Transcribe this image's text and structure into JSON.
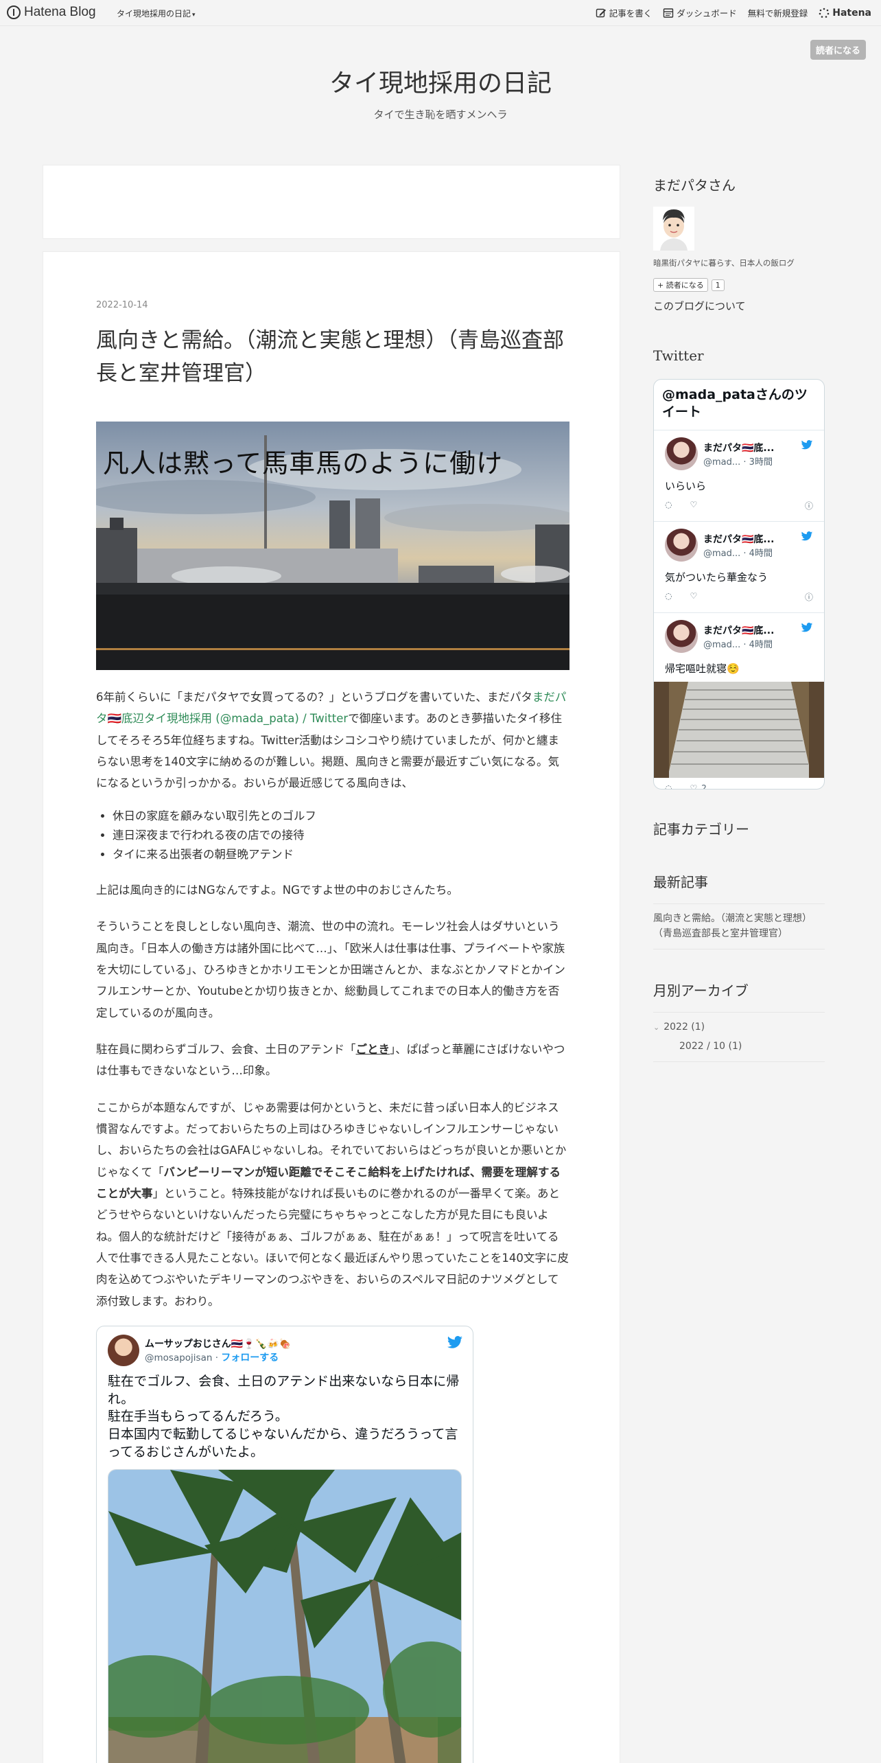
{
  "global_header": {
    "brand": "Hatena Blog",
    "blog_selector": "タイ現地採用の日記",
    "menu": {
      "write": "記事を書く",
      "dashboard": "ダッシュボード",
      "signup": "無料で新規登録",
      "hatena": "Hatena"
    }
  },
  "subscribe_button": "読者になる",
  "blog": {
    "title": "タイ現地採用の日記",
    "description": "タイで生き恥を晒すメンヘラ"
  },
  "entry": {
    "date": "2022-10-14",
    "title": "風向きと需給。（潮流と実態と理想）（青島巡査部長と室井管理官）",
    "eyecatch_caption": "凡人は黙って馬車馬のように働け",
    "p1_a": "6年前くらいに「まだパタヤで女買ってるの？」というブログを書いていた、まだパタ",
    "p1_link": "まだパタ🇹🇭底辺タイ現地採用 (@mada_pata) / Twitter",
    "p1_b": "で御座います。あのとき夢描いたタイ移住してそろそろ5年位経ちますね。Twitter活動はシコシコやり続けていましたが、何かと纏まらない思考を140文字に納めるのが難しい。掲題、風向きと需要が最近すごい気になる。気になるというか引っかかる。おいらが最近感じてる風向きは、",
    "list": [
      "休日の家庭を顧みない取引先とのゴルフ",
      "連日深夜まで行われる夜の店での接待",
      "タイに来る出張者の朝昼晩アテンド"
    ],
    "p2": "上記は風向き的にはNGなんですよ。NGですよ世の中のおじさんたち。",
    "p3": "そういうことを良しとしない風向き、潮流、世の中の流れ。モーレツ社会人はダサいという風向き。「日本人の働き方は諸外国に比べて…」、「欧米人は仕事は仕事、プライベートや家族を大切にしている」、ひろゆきとかホリエモンとか田端さんとか、まなぶとかノマドとかインフルエンサーとか、Youtubeとか切り抜きとか、総動員してこれまでの日本人的働き方を否定しているのが風向き。",
    "p4_a": "駐在員に関わらずゴルフ、会食、土日のアテンド「",
    "p4_em": "ごとき",
    "p4_b": "」、ぱぱっと華麗にさばけないやつは仕事もできないなという…印象。",
    "p5_a": "ここからが本題なんですが、じゃあ需要は何かというと、未だに昔っぽい日本人的ビジネス慣習なんですよ。だっておいらたちの上司はひろゆきじゃないしインフルエンサーじゃないし、おいらたちの会社はGAFAじゃないしね。それでいておいらはどっちが良いとか悪いとかじゃなくて「",
    "p5_strong": "バンピーリーマンが短い距離でそこそこ給料を上げたければ、需要を理解することが大事",
    "p5_b": "」ということ。特殊技能がなければ長いものに巻かれるのが一番早くて楽。あとどうせやらないといけないんだったら完璧にちゃちゃっとこなした方が見た目にも良いよね。個人的な統計だけど「接待がぁぁ、ゴルフがぁぁ、駐在がぁぁ！」って呪言を吐いてる人で仕事できる人見たことない。ほいで何となく最近ぼんやり思っていたことを140文字に皮肉を込めてつぶやいたデキリーマンのつぶやきを、おいらのスペルマ日記のナツメグとして添付致します。おわり。"
  },
  "embedded_tweet": {
    "display_name": "ムーサップおじさん🇹🇭🍷🍾🍻🍖",
    "handle": "@mosapojisan",
    "separator": " · ",
    "follow": "フォローする",
    "text": "駐在でゴルフ、会食、土日のアテンド出来ないなら日本に帰れ。\n駐在手当もらってるんだろう。\n日本国内で転勤してるじゃないんだから、違うだろうって言ってるおじさんがいたよ。"
  },
  "sidebar": {
    "profile_heading": "まだパタさん",
    "profile_desc": "暗黒街パタヤに暮らす、日本人の飯ログ",
    "reader_button": "読者になる",
    "reader_count": "1",
    "about_link": "このブログについて",
    "twitter_heading": "Twitter",
    "twitter_widget": {
      "title": "@mada_pataさんのツイート",
      "tweets": [
        {
          "name": "まだパタ🇹🇭底...",
          "handle": "@mad...",
          "time": " · 3時間",
          "text": "いらいら"
        },
        {
          "name": "まだパタ🇹🇭底...",
          "handle": "@mad...",
          "time": " · 4時間",
          "text": "気がついたら華金なう"
        },
        {
          "name": "まだパタ🇹🇭底...",
          "handle": "@mad...",
          "time": " · 4時間",
          "text": "帰宅嘔吐就寝☺️"
        }
      ],
      "last_like_count": "2"
    },
    "category_heading": "記事カテゴリー",
    "recent_heading": "最新記事",
    "recent_item": "風向きと需給。（潮流と実態と理想）（青島巡査部長と室井管理官）",
    "archive_heading": "月別アーカイブ",
    "archive_year": "2022 (1)",
    "archive_month": "2022 / 10 (1)"
  },
  "colors": {
    "background": "#f4f4f4",
    "link_green": "#2e8b57",
    "twitter_blue": "#1d9bf0",
    "subscribe_gray": "#b4b4b4"
  }
}
